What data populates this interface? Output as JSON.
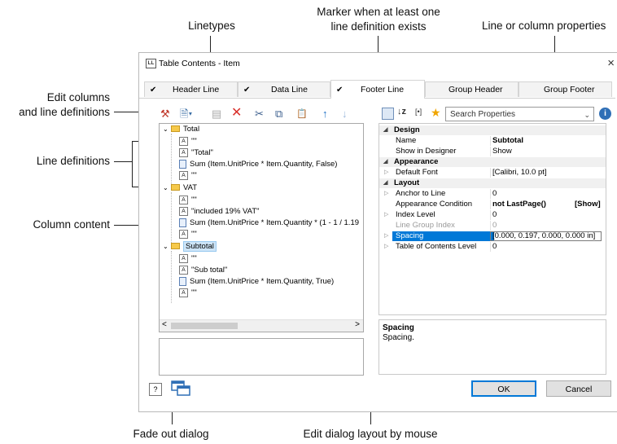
{
  "annotations": {
    "linetypes": "Linetypes",
    "marker_line1": "Marker when at least one",
    "marker_line2": "line definition exists",
    "line_props": "Line or column properties",
    "edit_columns_line1": "Edit columns",
    "edit_columns_line2": "and line definitions",
    "line_definitions": "Line definitions",
    "column_content": "Column content",
    "fade_out": "Fade out dialog",
    "edit_layout": "Edit dialog layout by mouse"
  },
  "dialog": {
    "app_icon": "LL",
    "title": "Table Contents - Item",
    "close": "×"
  },
  "tabs": [
    {
      "label": "Header Line",
      "checked": "✔"
    },
    {
      "label": "Data Line",
      "checked": "✔"
    },
    {
      "label": "Footer Line",
      "checked": "✔"
    },
    {
      "label": "Group Header",
      "checked": ""
    },
    {
      "label": "Group Footer",
      "checked": ""
    }
  ],
  "toolbar": {
    "icons": [
      "magic-wand-icon",
      "new-item-icon",
      "properties-icon",
      "delete-icon",
      "cut-icon",
      "copy-icon",
      "paste-icon",
      "move-up-icon",
      "move-down-icon"
    ],
    "glyphs": [
      "⚒",
      "🗎▾",
      "▤",
      "✕",
      "✂",
      "⧉",
      "📋",
      "↑",
      "↓"
    ]
  },
  "tree": {
    "groups": [
      {
        "label": "Total",
        "items": [
          {
            "type": "text",
            "text": "\"\""
          },
          {
            "type": "text",
            "text": "\"Total\""
          },
          {
            "type": "formula",
            "text": "Sum (Item.UnitPrice * Item.Quantity, False)"
          },
          {
            "type": "text",
            "text": "\"\""
          }
        ]
      },
      {
        "label": "VAT",
        "items": [
          {
            "type": "text",
            "text": "\"\""
          },
          {
            "type": "text",
            "text": "\"included 19% VAT\""
          },
          {
            "type": "formula",
            "text": "Sum (Item.UnitPrice * Item.Quantity * (1 - 1 / 1.19"
          },
          {
            "type": "text",
            "text": "\"\""
          }
        ]
      },
      {
        "label": "Subtotal",
        "items": [
          {
            "type": "text",
            "text": "\"\""
          },
          {
            "type": "text",
            "text": "\"Sub total\""
          },
          {
            "type": "formula",
            "text": "Sum (Item.UnitPrice * Item.Quantity, True)"
          },
          {
            "type": "text",
            "text": "\"\""
          }
        ]
      }
    ],
    "scroll_left": "<",
    "scroll_right": ">"
  },
  "property_toolbar": {
    "search_placeholder": "Search Properties",
    "dropdown": "⌄",
    "info": "i",
    "icons": [
      "categorized-icon",
      "sort-az-icon",
      "formula-icon",
      "favorites-icon"
    ]
  },
  "properties": {
    "design": "Design",
    "name_label": "Name",
    "name_value": "Subtotal",
    "show_label": "Show in Designer",
    "show_value": "Show",
    "appearance": "Appearance",
    "font_label": "Default Font",
    "font_value": "[Calibri, 10.0 pt]",
    "layout": "Layout",
    "anchor_label": "Anchor to Line",
    "anchor_value": "0",
    "cond_label": "Appearance Condition",
    "cond_value": "not LastPage()",
    "cond_show": "[Show]",
    "index_label": "Index Level",
    "index_value": "0",
    "lgi_label": "Line Group Index",
    "lgi_value": "0",
    "spacing_label": "Spacing",
    "spacing_value": "[0.000, 0.197, 0.000, 0.000 in]",
    "toc_label": "Table of Contents Level",
    "toc_value": "0"
  },
  "description": {
    "title": "Spacing",
    "text": "Spacing."
  },
  "buttons": {
    "help": "?",
    "ok": "OK",
    "cancel": "Cancel"
  }
}
